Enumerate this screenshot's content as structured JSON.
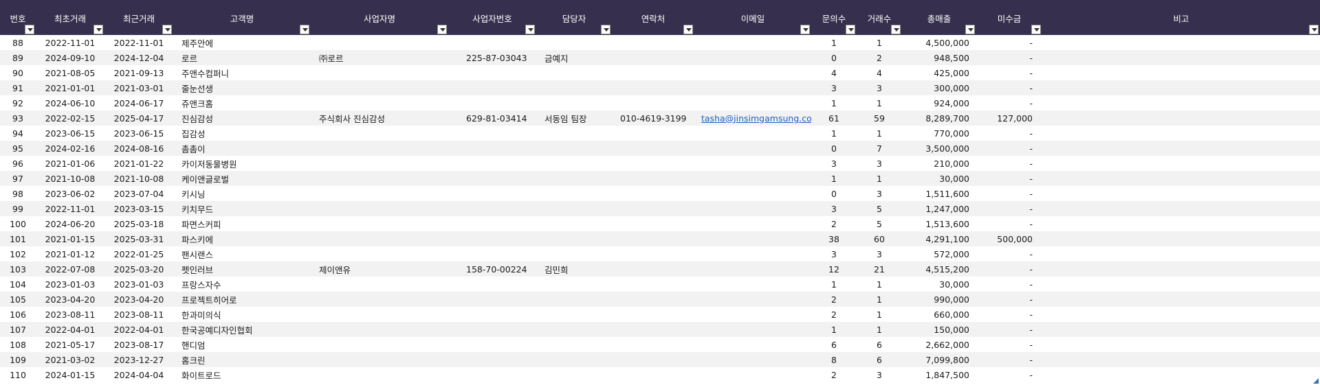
{
  "headers": [
    {
      "key": "no",
      "label": "번호"
    },
    {
      "key": "first",
      "label": "최초거래"
    },
    {
      "key": "last",
      "label": "최근거래"
    },
    {
      "key": "customer",
      "label": "고객명"
    },
    {
      "key": "company",
      "label": "사업자명"
    },
    {
      "key": "bizno",
      "label": "사업자번호"
    },
    {
      "key": "manager",
      "label": "담당자"
    },
    {
      "key": "contact",
      "label": "연락처"
    },
    {
      "key": "email",
      "label": "이메일"
    },
    {
      "key": "inq",
      "label": "문의수"
    },
    {
      "key": "deals",
      "label": "거래수"
    },
    {
      "key": "sales",
      "label": "총매출"
    },
    {
      "key": "unpaid",
      "label": "미수금"
    },
    {
      "key": "note",
      "label": "비고"
    }
  ],
  "rows": [
    {
      "no": "88",
      "first": "2022-11-01",
      "last": "2022-11-01",
      "customer": "제주안에",
      "company": "",
      "bizno": "",
      "manager": "",
      "contact": "",
      "email": "",
      "inq": "1",
      "deals": "1",
      "sales": "4,500,000",
      "unpaid": "-",
      "note": ""
    },
    {
      "no": "89",
      "first": "2024-09-10",
      "last": "2024-12-04",
      "customer": "로르",
      "company": "㈜로르",
      "bizno": "225-87-03043",
      "manager": "금예지",
      "contact": "",
      "email": "",
      "inq": "0",
      "deals": "2",
      "sales": "948,500",
      "unpaid": "-",
      "note": ""
    },
    {
      "no": "90",
      "first": "2021-08-05",
      "last": "2021-09-13",
      "customer": "주앤수컴퍼니",
      "company": "",
      "bizno": "",
      "manager": "",
      "contact": "",
      "email": "",
      "inq": "4",
      "deals": "4",
      "sales": "425,000",
      "unpaid": "-",
      "note": ""
    },
    {
      "no": "91",
      "first": "2021-01-01",
      "last": "2021-03-01",
      "customer": "줄눈선생",
      "company": "",
      "bizno": "",
      "manager": "",
      "contact": "",
      "email": "",
      "inq": "3",
      "deals": "3",
      "sales": "300,000",
      "unpaid": "-",
      "note": ""
    },
    {
      "no": "92",
      "first": "2024-06-10",
      "last": "2024-06-17",
      "customer": "쥬앤크홈",
      "company": "",
      "bizno": "",
      "manager": "",
      "contact": "",
      "email": "",
      "inq": "1",
      "deals": "1",
      "sales": "924,000",
      "unpaid": "-",
      "note": ""
    },
    {
      "no": "93",
      "first": "2022-02-15",
      "last": "2025-04-17",
      "customer": "진심감성",
      "company": "주식회사 진심감성",
      "bizno": "629-81-03414",
      "manager": "서동임 팀장",
      "contact": "010-4619-3199",
      "email": "tasha@jinsimgamsung.com",
      "inq": "61",
      "deals": "59",
      "sales": "8,289,700",
      "unpaid": "127,000",
      "note": ""
    },
    {
      "no": "94",
      "first": "2023-06-15",
      "last": "2023-06-15",
      "customer": "집감성",
      "company": "",
      "bizno": "",
      "manager": "",
      "contact": "",
      "email": "",
      "inq": "1",
      "deals": "1",
      "sales": "770,000",
      "unpaid": "-",
      "note": ""
    },
    {
      "no": "95",
      "first": "2024-02-16",
      "last": "2024-08-16",
      "customer": "촘촘이",
      "company": "",
      "bizno": "",
      "manager": "",
      "contact": "",
      "email": "",
      "inq": "0",
      "deals": "7",
      "sales": "3,500,000",
      "unpaid": "-",
      "note": ""
    },
    {
      "no": "96",
      "first": "2021-01-06",
      "last": "2021-01-22",
      "customer": "카이저동물병원",
      "company": "",
      "bizno": "",
      "manager": "",
      "contact": "",
      "email": "",
      "inq": "3",
      "deals": "3",
      "sales": "210,000",
      "unpaid": "-",
      "note": ""
    },
    {
      "no": "97",
      "first": "2021-10-08",
      "last": "2021-10-08",
      "customer": "케이앤글로벌",
      "company": "",
      "bizno": "",
      "manager": "",
      "contact": "",
      "email": "",
      "inq": "1",
      "deals": "1",
      "sales": "30,000",
      "unpaid": "-",
      "note": ""
    },
    {
      "no": "98",
      "first": "2023-06-02",
      "last": "2023-07-04",
      "customer": "키시닝",
      "company": "",
      "bizno": "",
      "manager": "",
      "contact": "",
      "email": "",
      "inq": "0",
      "deals": "3",
      "sales": "1,511,600",
      "unpaid": "-",
      "note": ""
    },
    {
      "no": "99",
      "first": "2022-11-01",
      "last": "2023-03-15",
      "customer": "키치무드",
      "company": "",
      "bizno": "",
      "manager": "",
      "contact": "",
      "email": "",
      "inq": "3",
      "deals": "5",
      "sales": "1,247,000",
      "unpaid": "-",
      "note": ""
    },
    {
      "no": "100",
      "first": "2024-06-20",
      "last": "2025-03-18",
      "customer": "파면스커피",
      "company": "",
      "bizno": "",
      "manager": "",
      "contact": "",
      "email": "",
      "inq": "2",
      "deals": "5",
      "sales": "1,513,600",
      "unpaid": "-",
      "note": ""
    },
    {
      "no": "101",
      "first": "2021-01-15",
      "last": "2025-03-31",
      "customer": "파스키에",
      "company": "",
      "bizno": "",
      "manager": "",
      "contact": "",
      "email": "",
      "inq": "38",
      "deals": "60",
      "sales": "4,291,100",
      "unpaid": "500,000",
      "note": ""
    },
    {
      "no": "102",
      "first": "2021-01-12",
      "last": "2022-01-25",
      "customer": "팬시랜스",
      "company": "",
      "bizno": "",
      "manager": "",
      "contact": "",
      "email": "",
      "inq": "3",
      "deals": "3",
      "sales": "572,000",
      "unpaid": "-",
      "note": ""
    },
    {
      "no": "103",
      "first": "2022-07-08",
      "last": "2025-03-20",
      "customer": "펫인러브",
      "company": "제이앤유",
      "bizno": "158-70-00224",
      "manager": "김민희",
      "contact": "",
      "email": "",
      "inq": "12",
      "deals": "21",
      "sales": "4,515,200",
      "unpaid": "-",
      "note": ""
    },
    {
      "no": "104",
      "first": "2023-01-03",
      "last": "2023-01-03",
      "customer": "프랑스자수",
      "company": "",
      "bizno": "",
      "manager": "",
      "contact": "",
      "email": "",
      "inq": "1",
      "deals": "1",
      "sales": "30,000",
      "unpaid": "-",
      "note": ""
    },
    {
      "no": "105",
      "first": "2023-04-20",
      "last": "2023-04-20",
      "customer": "프로젝트히어로",
      "company": "",
      "bizno": "",
      "manager": "",
      "contact": "",
      "email": "",
      "inq": "2",
      "deals": "1",
      "sales": "990,000",
      "unpaid": "-",
      "note": ""
    },
    {
      "no": "106",
      "first": "2023-08-11",
      "last": "2023-08-11",
      "customer": "한과미의식",
      "company": "",
      "bizno": "",
      "manager": "",
      "contact": "",
      "email": "",
      "inq": "2",
      "deals": "1",
      "sales": "660,000",
      "unpaid": "-",
      "note": ""
    },
    {
      "no": "107",
      "first": "2022-04-01",
      "last": "2022-04-01",
      "customer": "한국공예디자인협회",
      "company": "",
      "bizno": "",
      "manager": "",
      "contact": "",
      "email": "",
      "inq": "1",
      "deals": "1",
      "sales": "150,000",
      "unpaid": "-",
      "note": ""
    },
    {
      "no": "108",
      "first": "2021-05-17",
      "last": "2023-08-17",
      "customer": "핸디엄",
      "company": "",
      "bizno": "",
      "manager": "",
      "contact": "",
      "email": "",
      "inq": "6",
      "deals": "6",
      "sales": "2,662,000",
      "unpaid": "-",
      "note": ""
    },
    {
      "no": "109",
      "first": "2021-03-02",
      "last": "2023-12-27",
      "customer": "홈크린",
      "company": "",
      "bizno": "",
      "manager": "",
      "contact": "",
      "email": "",
      "inq": "8",
      "deals": "6",
      "sales": "7,099,800",
      "unpaid": "-",
      "note": ""
    },
    {
      "no": "110",
      "first": "2024-01-15",
      "last": "2024-04-04",
      "customer": "화이트로드",
      "company": "",
      "bizno": "",
      "manager": "",
      "contact": "",
      "email": "",
      "inq": "2",
      "deals": "3",
      "sales": "1,847,500",
      "unpaid": "-",
      "note": ""
    }
  ]
}
